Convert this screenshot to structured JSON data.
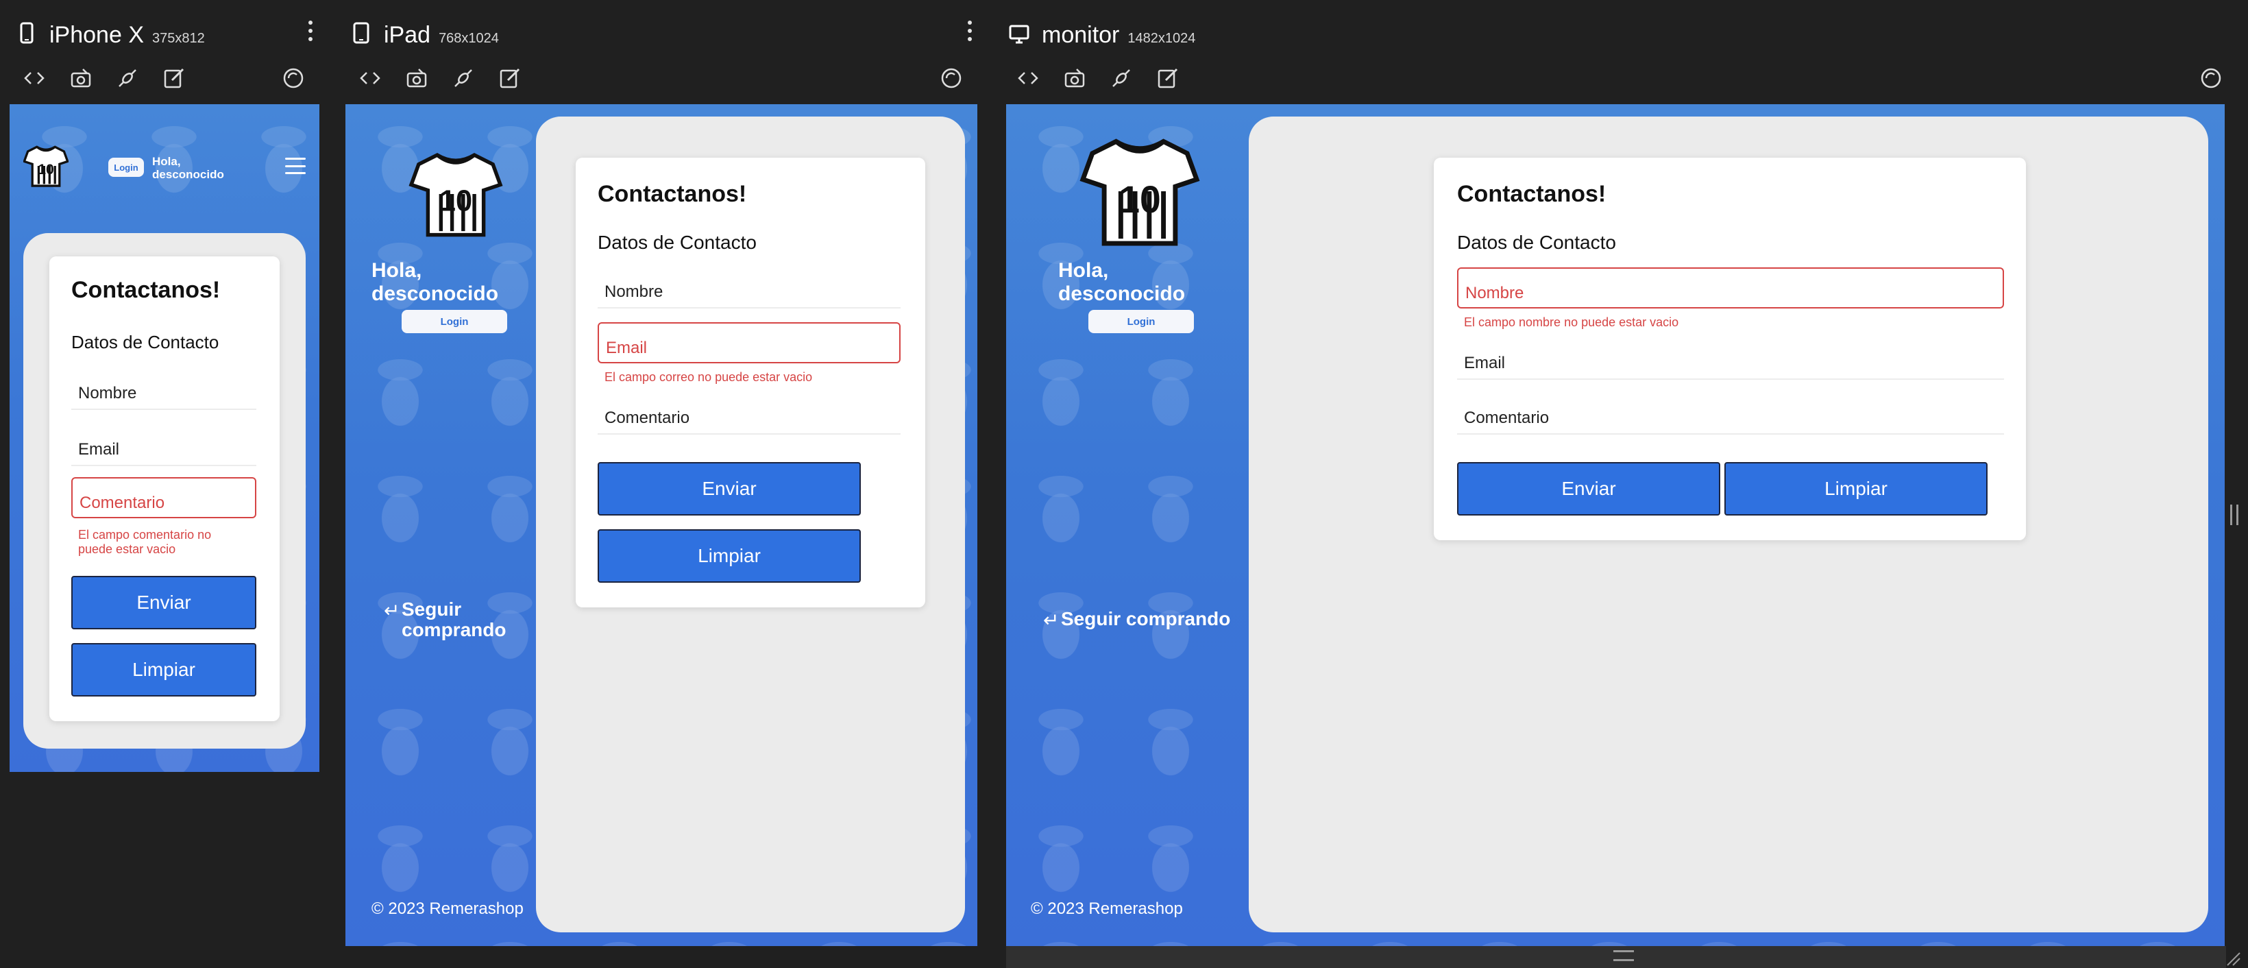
{
  "devices": {
    "iphone": {
      "name": "iPhone X",
      "size": "375x812"
    },
    "ipad": {
      "name": "iPad",
      "size": "768x1024"
    },
    "monitor": {
      "name": "monitor",
      "size": "1482x1024"
    }
  },
  "toolbar_icons": [
    "code-icon",
    "camera-icon",
    "plug-icon",
    "edit-icon",
    "rotate-icon"
  ],
  "site": {
    "greeting_line1": "Hola,",
    "greeting_line2": "desconocido",
    "login": "Login",
    "back_line1": "Seguir",
    "back_line2": "comprando",
    "back_full": "Seguir comprando",
    "footer": "© 2023 Remerashop",
    "jersey_number": "10"
  },
  "form": {
    "title": "Contactanos!",
    "subtitle": "Datos de Contacto",
    "name_placeholder": "Nombre",
    "email_placeholder": "Email",
    "comment_placeholder": "Comentario",
    "submit": "Enviar",
    "clear": "Limpiar"
  },
  "errors": {
    "comment_line1": "El campo comentario no",
    "comment_line2": "puede estar vacio",
    "email": "El campo correo no puede estar vacio",
    "name": "El campo nombre no puede estar vacio"
  },
  "colors": {
    "primary": "#2f71e0",
    "error": "#d64545",
    "background": "#202020",
    "panel": "#ebebeb"
  }
}
